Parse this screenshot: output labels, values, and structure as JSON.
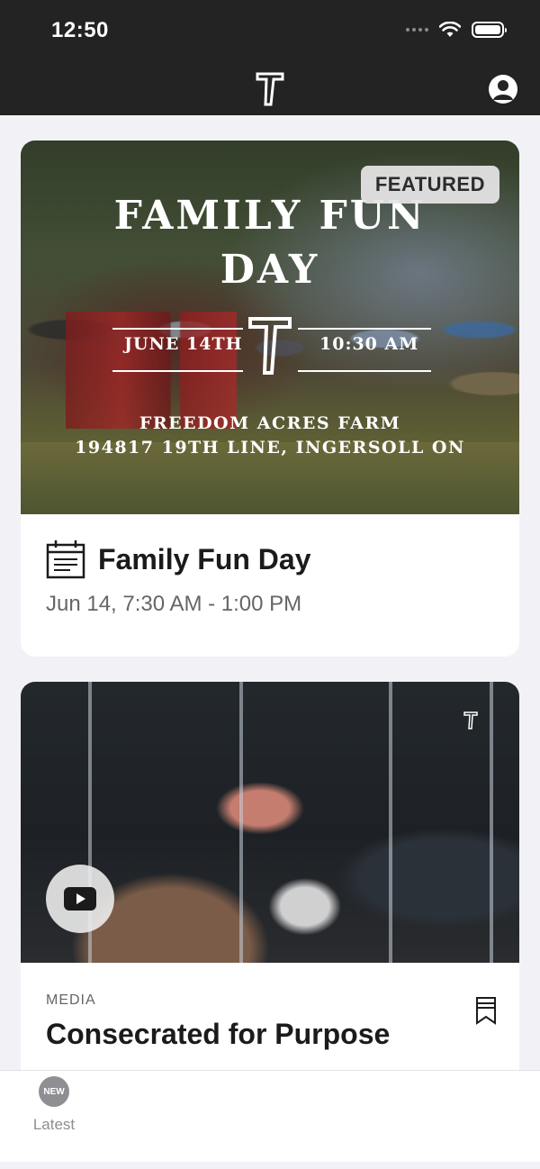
{
  "status_bar": {
    "time": "12:50"
  },
  "event_card": {
    "badge": "FEATURED",
    "poster": {
      "title_line1": "FAMILY FUN",
      "title_line2": "DAY",
      "date": "JUNE 14TH",
      "time": "10:30 AM",
      "place": "FREEDOM ACRES FARM",
      "address": "194817 19TH LINE, INGERSOLL ON"
    },
    "title": "Family Fun Day",
    "datetime": "Jun 14, 7:30 AM - 1:00 PM",
    "icon": "calendar-icon"
  },
  "media_card": {
    "category": "MEDIA",
    "title": "Consecrated for Purpose",
    "play_icon": "play-icon",
    "bookmark_icon": "bookmark-icon"
  },
  "tab_bar": {
    "tabs": [
      {
        "label": "Latest",
        "badge": "NEW"
      }
    ]
  }
}
